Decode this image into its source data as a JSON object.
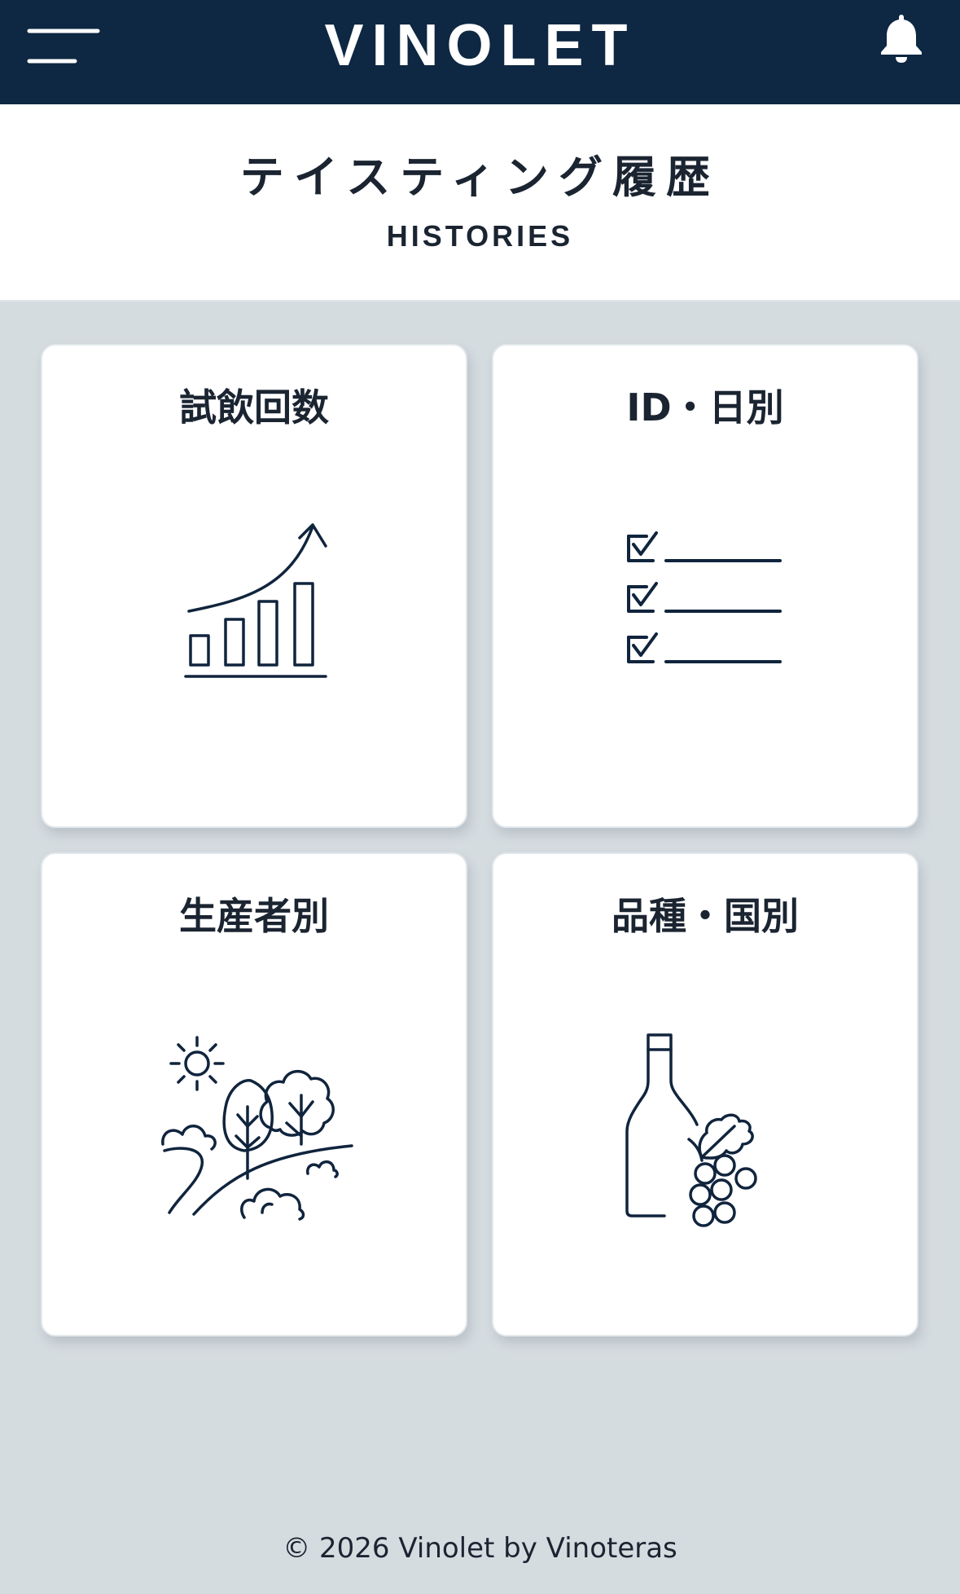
{
  "header": {
    "menu_icon": "hamburger-menu-icon",
    "brand": "VINOLET",
    "notification_icon": "bell-icon",
    "background_color": "#0e2742"
  },
  "page": {
    "title": "テイスティング履歴",
    "subtitle": "HISTORIES"
  },
  "cards": [
    {
      "label": "試飲回数",
      "icon": "growth-bar-chart-icon"
    },
    {
      "label": "ID・日別",
      "icon": "checklist-icon"
    },
    {
      "label": "生産者別",
      "icon": "landscape-trees-icon"
    },
    {
      "label": "品種・国別",
      "icon": "wine-bottle-grapes-icon"
    }
  ],
  "footer": {
    "copyright": "© 2026 Vinolet by Vinoteras"
  },
  "colors": {
    "accent": "#0e2742",
    "background": "#d5dce0",
    "card": "#ffffff",
    "text": "#1b2431"
  }
}
